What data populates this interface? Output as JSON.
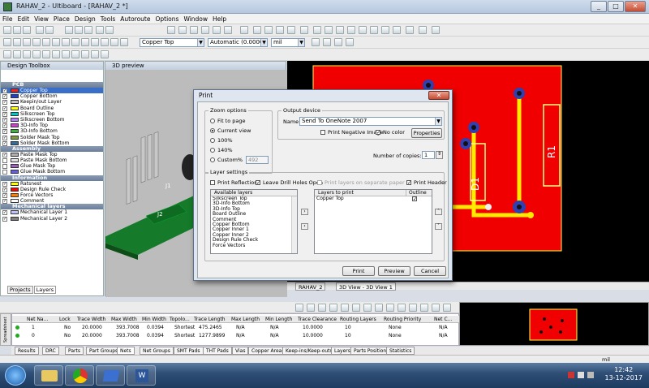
{
  "window": {
    "title": "RAHAV_2 - Ultiboard - [RAHAV_2 *]",
    "min": "_",
    "max": "□",
    "close": "✕"
  },
  "menu": [
    "File",
    "Edit",
    "View",
    "Place",
    "Design",
    "Tools",
    "Autoroute",
    "Options",
    "Window",
    "Help"
  ],
  "toolbar": {
    "layer_select": "Copper Top",
    "grid_select": "Automatic (0.0000 mil",
    "unit_select": "mil"
  },
  "design_toolbox": {
    "title": "Design Toolbox",
    "sections": [
      {
        "name": "PCB",
        "items": [
          {
            "label": "Copper Top",
            "color": "#ff2020",
            "checked": true,
            "selected": true
          },
          {
            "label": "Copper Bottom",
            "color": "#1f3fd0",
            "checked": true
          },
          {
            "label": "Keepin/out Layer",
            "color": "#c0c0c0",
            "checked": true
          },
          {
            "label": "Board Outline",
            "color": "#ffff00",
            "checked": true
          },
          {
            "label": "Silkscreen Top",
            "color": "#00c8c8",
            "checked": true
          },
          {
            "label": "Silkscreen Bottom",
            "color": "#b080ff",
            "checked": true
          },
          {
            "label": "3D-Info Top",
            "color": "#d040d0",
            "checked": true
          },
          {
            "label": "3D-Info Bottom",
            "color": "#40b040",
            "checked": true
          },
          {
            "label": "Solder Mask Top",
            "color": "#7e9e3c",
            "checked": true
          },
          {
            "label": "Solder Mask Bottom",
            "color": "#306e9e",
            "checked": true
          }
        ]
      },
      {
        "name": "Assembly",
        "items": [
          {
            "label": "Paste Mask Top",
            "color": "#b0b0b0",
            "checked": true
          },
          {
            "label": "Paste Mask Bottom",
            "color": "#e0e0e0",
            "checked": false
          },
          {
            "label": "Glue Mask Top",
            "color": "#a060c0",
            "checked": false
          },
          {
            "label": "Glue Mask Bottom",
            "color": "#6060e0",
            "checked": false
          }
        ]
      },
      {
        "name": "Information",
        "items": [
          {
            "label": "Ratsnest",
            "color": "#ffff00",
            "checked": true
          },
          {
            "label": "Design Rule Check",
            "color": "#ff0000",
            "checked": true
          },
          {
            "label": "Force Vectors",
            "color": "#ff8000",
            "checked": true
          },
          {
            "label": "Comment",
            "color": "#ffffff",
            "checked": true
          }
        ]
      },
      {
        "name": "Mechanical layers",
        "items": [
          {
            "label": "Mechanical Layer 1",
            "color": "#c0c0ff",
            "checked": true
          },
          {
            "label": "Mechanical Layer 2",
            "color": "#808080",
            "checked": true
          }
        ]
      }
    ],
    "tabs": [
      "Projects",
      "Layers"
    ]
  },
  "preview": {
    "title": "3D preview"
  },
  "view_tabs": [
    "RAHAV_2",
    "3D View - 3D View 1"
  ],
  "pcb": {
    "label_d1": "D1",
    "label_r1": "R1"
  },
  "print_dialog": {
    "title": "Print",
    "zoom_group": "Zoom options",
    "zoom_options": [
      "Fit to page",
      "Current view",
      "100%",
      "140%",
      "Custom%"
    ],
    "zoom_selected": "Current view",
    "custom_value": "492",
    "output_group": "Output device",
    "name_label": "Name",
    "printer": "Send To OneNote 2007",
    "print_negative": "Print Negative Image",
    "no_color": "No color",
    "properties": "Properties",
    "copies_label": "Number of copies:",
    "copies": "1",
    "layer_group": "Layer settings",
    "print_reflection": "Print Reflection",
    "leave_drill": "Leave Drill Holes Open",
    "print_separate": "Print layers on separate paper",
    "print_header": "Print Header",
    "available_header": "Available layers",
    "available_layers": [
      "Silkscreen Top",
      "3D-Info Bottom",
      "3D-Info Top",
      "Board Outline",
      "Comment",
      "Copper Bottom",
      "Copper Inner 1",
      "Copper Inner 2",
      "Design Rule Check",
      "Force Vectors"
    ],
    "to_print_header": "Layers to print",
    "outline_header": "Outline",
    "layers_to_print": [
      {
        "name": "Copper Top",
        "outline": true
      }
    ],
    "buttons": {
      "print": "Print",
      "preview": "Preview",
      "cancel": "Cancel"
    }
  },
  "net_grid": {
    "columns": [
      "Net Na...",
      "Lock",
      "Trace Width",
      "Max Width",
      "Min Width",
      "Topolo...",
      "Trace Length",
      "Max Length",
      "Min Length",
      "Trace Clearance",
      "Routing Layers",
      "Routing Priority",
      "Net C..."
    ],
    "rows": [
      [
        "1",
        "No",
        "20.0000",
        "393.7008",
        "0.0394",
        "Shortest",
        "475.2465",
        "N/A",
        "N/A",
        "10.0000",
        "10",
        "None",
        "N/A"
      ],
      [
        "0",
        "No",
        "20.0000",
        "393.7008",
        "0.0394",
        "Shortest",
        "1277.9899",
        "N/A",
        "N/A",
        "10.0000",
        "10",
        "None",
        "N/A"
      ]
    ]
  },
  "spreadsheet_label": "Spreadsheet View",
  "bottom_tabs": [
    "Results",
    "DRC",
    "Parts",
    "Part Groups",
    "Nets",
    "Net Groups",
    "SMT Pads",
    "THT Pads",
    "Vias",
    "Copper Areas",
    "Keep-ins/Keep-outs",
    "Layers",
    "Parts Position",
    "Statistics"
  ],
  "status": {
    "unit": "mil"
  },
  "clock": {
    "time": "12:42",
    "date": "13-12-2017"
  }
}
